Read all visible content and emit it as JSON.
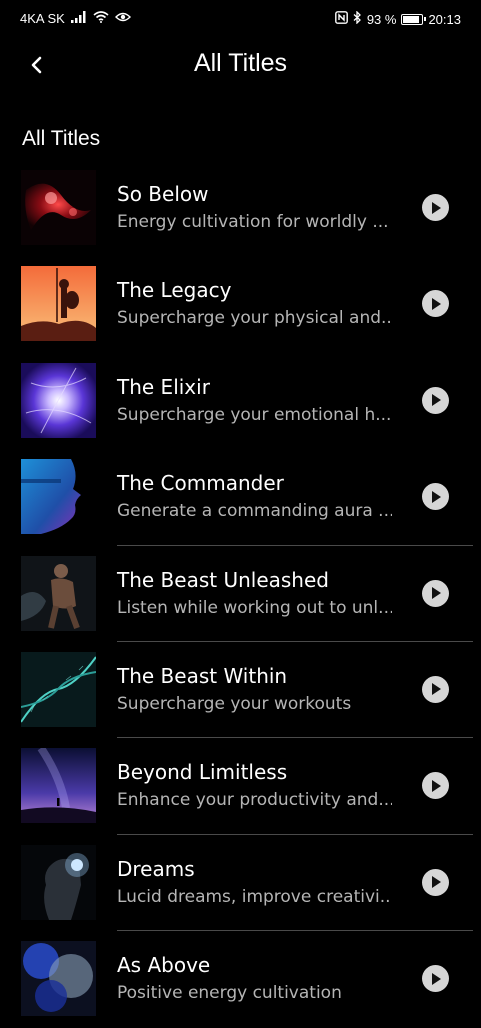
{
  "status_bar": {
    "carrier": "4KA SK",
    "battery_percent": "93 %",
    "battery_level": 0.93,
    "time": "20:13",
    "icons": [
      "signal-icon",
      "wifi-icon",
      "eye-icon",
      "nfc-icon",
      "bluetooth-icon",
      "battery-icon"
    ]
  },
  "header": {
    "title": "All Titles",
    "back_icon": "chevron-left-icon"
  },
  "section": {
    "title": "All Titles"
  },
  "items": [
    {
      "title": "So Below",
      "subtitle": "Energy cultivation for worldly ...",
      "thumb": "red-nebula",
      "divider": false
    },
    {
      "title": "The Legacy",
      "subtitle": "Supercharge your physical and...",
      "thumb": "spartan-warrior",
      "divider": false
    },
    {
      "title": "The Elixir",
      "subtitle": "Supercharge your emotional h...",
      "thumb": "purple-energy-orb",
      "divider": false
    },
    {
      "title": "The Commander",
      "subtitle": "Generate a commanding aura ...",
      "thumb": "blue-statue-face",
      "divider": true
    },
    {
      "title": "The Beast Unleashed",
      "subtitle": "Listen while working out to unl...",
      "thumb": "muscular-runner",
      "divider": true
    },
    {
      "title": "The Beast Within",
      "subtitle": "Supercharge your workouts",
      "thumb": "dna-helix",
      "divider": true
    },
    {
      "title": "Beyond Limitless",
      "subtitle": "Enhance your productivity and...",
      "thumb": "night-sky-figure",
      "divider": true
    },
    {
      "title": "Dreams",
      "subtitle": "Lucid dreams, improve creativi...",
      "thumb": "glowing-head-profile",
      "divider": true
    },
    {
      "title": "As Above",
      "subtitle": "Positive energy cultivation",
      "thumb": "blue-cosmic-cloud",
      "divider": false
    }
  ],
  "colors": {
    "background": "#000000",
    "subtitle": "#b5b5b5",
    "play_button": "#d6d6d6",
    "divider": "#4a4a4a"
  }
}
